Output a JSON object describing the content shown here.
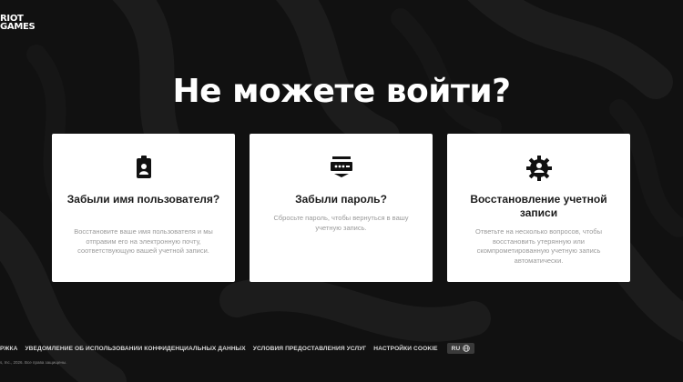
{
  "brand": {
    "logo_line1": "RIOT",
    "logo_line2": "GAMES"
  },
  "page": {
    "heading": "Не можете войти?"
  },
  "cards": [
    {
      "title": "Забыли имя пользователя?",
      "description": "Восстановите ваше имя пользователя и мы отправим его на электронную почту, соответствующую вашей учетной записи.",
      "icon": "id-badge-icon"
    },
    {
      "title": "Забыли пароль?",
      "description": "Сбросьте пароль, чтобы вернуться в вашу учетную запись.",
      "icon": "password-icon"
    },
    {
      "title": "Восстановление учетной записи",
      "description": "Ответьте на несколько вопросов, чтобы восстановить утерянную или скомпрометированную учетную запись автоматически.",
      "icon": "gear-user-icon"
    }
  ],
  "footer": {
    "links": [
      "РЖКА",
      "УВЕДОМЛЕНИЕ ОБ ИСПОЛЬЗОВАНИИ КОНФИДЕНЦИАЛЬНЫХ ДАННЫХ",
      "УСЛОВИЯ ПРЕДОСТАВЛЕНИЯ УСЛУГ",
      "НАСТРОЙКИ COOKIE"
    ],
    "language": "RU",
    "copyright": "s, Inc., 2026. Все права защищены."
  },
  "colors": {
    "background": "#111111",
    "card": "#ffffff",
    "muted_text": "#9a9a9a"
  }
}
